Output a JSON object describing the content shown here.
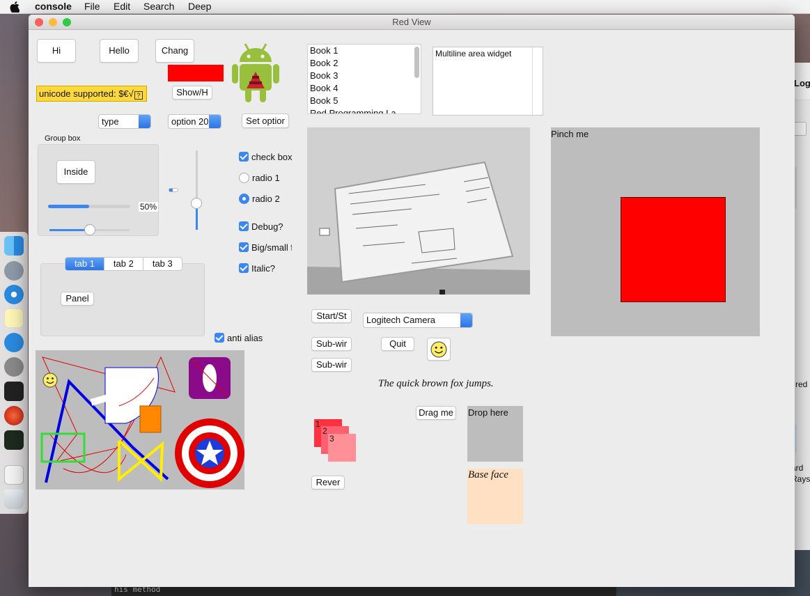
{
  "menubar": {
    "app": "console",
    "items": [
      "File",
      "Edit",
      "Search",
      "Deep"
    ]
  },
  "background": {
    "terminal_line": "his method",
    "side_labels": [
      "Log",
      "red",
      "ard",
      "Rays"
    ]
  },
  "window": {
    "title": "Red View"
  },
  "buttons": {
    "hi": "Hi",
    "hello": "Hello",
    "change": "Chang",
    "show_hide": "Show/H",
    "set_option": "Set optior",
    "inside": "Inside",
    "panel": "Panel",
    "start_stop": "Start/St",
    "sub_window_1": "Sub-wir",
    "sub_window_2": "Sub-wir",
    "quit": "Quit",
    "drag_me": "Drag me",
    "reverse": "Rever"
  },
  "unicode_label": "unicode supported: $€√",
  "selects": {
    "type": "type",
    "option": "option 20",
    "camera": "Logitech Camera"
  },
  "group_box": {
    "title": "Group box",
    "progress_percent": 50,
    "progress_text": "50%",
    "slider_fraction": 0.5
  },
  "vertical_slider_fraction": 0.33,
  "checks": {
    "check_box": "check box",
    "radio1": "radio 1",
    "radio2": "radio 2",
    "debug": "Debug?",
    "big_small": "Big/small f",
    "italic": "Italic?",
    "anti_alias": "anti alias"
  },
  "tabs": [
    "tab 1",
    "tab 2",
    "tab 3"
  ],
  "book_list": [
    "Book 1",
    "Book 2",
    "Book 3",
    "Book 4",
    "Book 5",
    "Red Programming La"
  ],
  "multiline": "Multiline area widget",
  "pinch": "Pinch me",
  "fox_text": "The quick brown fox jumps.",
  "stack_labels": [
    "1",
    "2",
    "3"
  ],
  "drop_here": "Drop here",
  "base_face": "Base face",
  "colors": {
    "red": "#ff0000",
    "accent": "#3b86f0",
    "peach": "#ffe0c2",
    "android": "#98c03c"
  }
}
